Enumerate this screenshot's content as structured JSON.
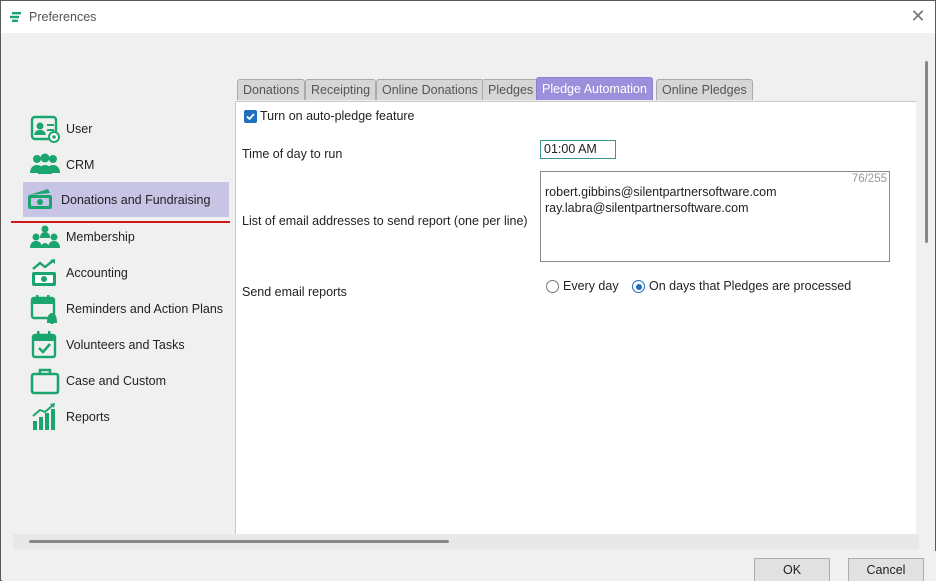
{
  "window": {
    "title": "Preferences"
  },
  "sidebar": {
    "items": [
      {
        "label": "User",
        "icon": "user-card-icon"
      },
      {
        "label": "CRM",
        "icon": "people-icon"
      },
      {
        "label": "Donations and Fundraising",
        "icon": "money-hand-icon"
      },
      {
        "label": "Membership",
        "icon": "membership-icon"
      },
      {
        "label": "Accounting",
        "icon": "accounting-icon"
      },
      {
        "label": "Reminders and Action Plans",
        "icon": "calendar-bell-icon"
      },
      {
        "label": "Volunteers and Tasks",
        "icon": "calendar-check-icon"
      },
      {
        "label": "Case and Custom",
        "icon": "briefcase-icon"
      },
      {
        "label": "Reports",
        "icon": "bar-chart-icon"
      }
    ],
    "selected": "Donations and Fundraising"
  },
  "tabs": [
    {
      "label": "Donations"
    },
    {
      "label": "Receipting"
    },
    {
      "label": "Online Donations"
    },
    {
      "label": "Pledges"
    },
    {
      "label": "Pledge Automation"
    },
    {
      "label": "Online Pledges"
    }
  ],
  "active_tab": "Pledge Automation",
  "form": {
    "auto_pledge_label": "Turn on auto-pledge feature",
    "auto_pledge_checked": true,
    "time_label": "Time of day to run",
    "time_value": "01:00 AM",
    "email_label": "List of email addresses to send report (one per line)",
    "email_count": "76/255",
    "emails": [
      "robert.gibbins@silentpartnersoftware.com",
      "ray.labra@silentpartnersoftware.com"
    ],
    "send_label": "Send email reports",
    "radio_every_day": "Every day",
    "radio_pledge_days": "On days that Pledges are processed",
    "selected_option": "On days that Pledges are processed"
  },
  "buttons": {
    "ok": "OK",
    "cancel": "Cancel"
  },
  "colors": {
    "accent_green": "#1aa56f",
    "selected_bg": "#c7c4e6",
    "active_tab": "#9c90dc",
    "highlight_red": "#d01818",
    "check_blue": "#1f6fbf"
  }
}
